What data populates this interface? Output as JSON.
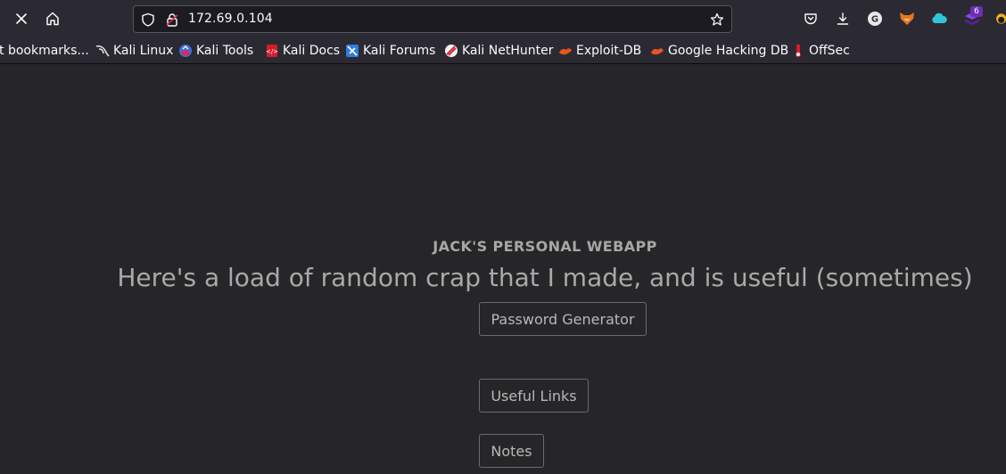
{
  "browser": {
    "url": "172.69.0.104",
    "extension_badge": "6"
  },
  "bookmarks": [
    {
      "label": "t bookmarks...",
      "icon": "none"
    },
    {
      "label": "Kali Linux",
      "icon": "kali-dragon-icon"
    },
    {
      "label": "Kali Tools",
      "icon": "kali-tools-icon"
    },
    {
      "label": "Kali Docs",
      "icon": "kali-docs-icon"
    },
    {
      "label": "Kali Forums",
      "icon": "kali-forums-icon"
    },
    {
      "label": "Kali NetHunter",
      "icon": "kali-nethunter-icon"
    },
    {
      "label": "Exploit-DB",
      "icon": "exploit-db-icon"
    },
    {
      "label": "Google Hacking DB",
      "icon": "ghdb-icon"
    },
    {
      "label": "OffSec",
      "icon": "offsec-icon"
    }
  ],
  "page": {
    "title": "JACK'S PERSONAL WEBAPP",
    "subtitle": "Here's a load of random crap that I made, and is useful (sometimes)",
    "buttons": {
      "password_generator": "Password Generator",
      "useful_links": "Useful Links",
      "notes": "Notes"
    }
  },
  "colors": {
    "toolbar_bg": "#2b2a33",
    "urlbar_bg": "#1c1b22",
    "page_bg": "#262628",
    "text_muted": "#a9a9a9"
  }
}
